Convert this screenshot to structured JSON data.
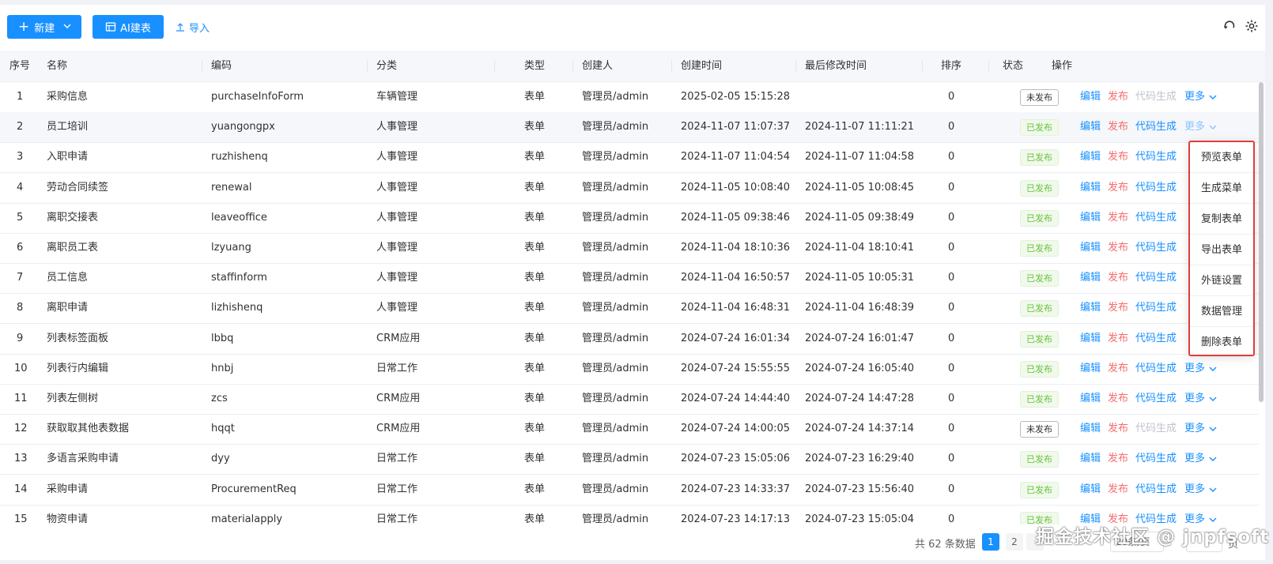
{
  "toolbar": {
    "new_label": "新建",
    "ai_label": "AI建表",
    "import_label": "导入"
  },
  "table": {
    "headers": {
      "index": "序号",
      "name": "名称",
      "code": "编码",
      "category": "分类",
      "type": "类型",
      "creator": "创建人",
      "created": "创建时间",
      "modified": "最后修改时间",
      "sort": "排序",
      "status": "状态",
      "ops": "操作"
    },
    "rows": [
      {
        "index": "1",
        "name": "采购信息",
        "code": "purchaseInfoForm",
        "category": "车辆管理",
        "type": "表单",
        "creator": "管理员/admin",
        "created": "2025-02-05 15:15:28",
        "modified": "",
        "sort": "0",
        "status": "未发布",
        "published": false,
        "code_gen": "代码生成",
        "more": "更多"
      },
      {
        "index": "2",
        "name": "员工培训",
        "code": "yuangongpx",
        "category": "人事管理",
        "type": "表单",
        "creator": "管理员/admin",
        "created": "2024-11-07 11:07:37",
        "modified": "2024-11-07 11:11:21",
        "sort": "0",
        "status": "已发布",
        "published": true,
        "code_gen": "代码生成",
        "more": "更多"
      },
      {
        "index": "3",
        "name": "入职申请",
        "code": "ruzhishenq",
        "category": "人事管理",
        "type": "表单",
        "creator": "管理员/admin",
        "created": "2024-11-07 11:04:54",
        "modified": "2024-11-07 11:04:58",
        "sort": "0",
        "status": "已发布",
        "published": true,
        "code_gen": "代码生成",
        "more": ""
      },
      {
        "index": "4",
        "name": "劳动合同续签",
        "code": "renewal",
        "category": "人事管理",
        "type": "表单",
        "creator": "管理员/admin",
        "created": "2024-11-05 10:08:40",
        "modified": "2024-11-05 10:08:45",
        "sort": "0",
        "status": "已发布",
        "published": true,
        "code_gen": "代码生成",
        "more": ""
      },
      {
        "index": "5",
        "name": "离职交接表",
        "code": "leaveoffice",
        "category": "人事管理",
        "type": "表单",
        "creator": "管理员/admin",
        "created": "2024-11-05 09:38:46",
        "modified": "2024-11-05 09:38:49",
        "sort": "0",
        "status": "已发布",
        "published": true,
        "code_gen": "代码生成",
        "more": ""
      },
      {
        "index": "6",
        "name": "离职员工表",
        "code": "lzyuang",
        "category": "人事管理",
        "type": "表单",
        "creator": "管理员/admin",
        "created": "2024-11-04 18:10:36",
        "modified": "2024-11-04 18:10:41",
        "sort": "0",
        "status": "已发布",
        "published": true,
        "code_gen": "代码生成",
        "more": ""
      },
      {
        "index": "7",
        "name": "员工信息",
        "code": "staffinform",
        "category": "人事管理",
        "type": "表单",
        "creator": "管理员/admin",
        "created": "2024-11-04 16:50:57",
        "modified": "2024-11-05 10:05:31",
        "sort": "0",
        "status": "已发布",
        "published": true,
        "code_gen": "代码生成",
        "more": ""
      },
      {
        "index": "8",
        "name": "离职申请",
        "code": "lizhishenq",
        "category": "人事管理",
        "type": "表单",
        "creator": "管理员/admin",
        "created": "2024-11-04 16:48:31",
        "modified": "2024-11-04 16:48:39",
        "sort": "0",
        "status": "已发布",
        "published": true,
        "code_gen": "代码生成",
        "more": ""
      },
      {
        "index": "9",
        "name": "列表标签面板",
        "code": "lbbq",
        "category": "CRM应用",
        "type": "表单",
        "creator": "管理员/admin",
        "created": "2024-07-24 16:01:34",
        "modified": "2024-07-24 16:01:47",
        "sort": "0",
        "status": "已发布",
        "published": true,
        "code_gen": "代码生成",
        "more": ""
      },
      {
        "index": "10",
        "name": "列表行内编辑",
        "code": "hnbj",
        "category": "日常工作",
        "type": "表单",
        "creator": "管理员/admin",
        "created": "2024-07-24 15:55:55",
        "modified": "2024-07-24 16:05:40",
        "sort": "0",
        "status": "已发布",
        "published": true,
        "code_gen": "代码生成",
        "more": "更多"
      },
      {
        "index": "11",
        "name": "列表左侧树",
        "code": "zcs",
        "category": "CRM应用",
        "type": "表单",
        "creator": "管理员/admin",
        "created": "2024-07-24 14:44:40",
        "modified": "2024-07-24 14:47:28",
        "sort": "0",
        "status": "已发布",
        "published": true,
        "code_gen": "代码生成",
        "more": "更多"
      },
      {
        "index": "12",
        "name": "获取取其他表数据",
        "code": "hqqt",
        "category": "CRM应用",
        "type": "表单",
        "creator": "管理员/admin",
        "created": "2024-07-24 14:00:05",
        "modified": "2024-07-24 14:37:14",
        "sort": "0",
        "status": "未发布",
        "published": false,
        "code_gen": "代码生成",
        "more": "更多"
      },
      {
        "index": "13",
        "name": "多语言采购申请",
        "code": "dyy",
        "category": "日常工作",
        "type": "表单",
        "creator": "管理员/admin",
        "created": "2024-07-23 15:05:06",
        "modified": "2024-07-23 16:29:40",
        "sort": "0",
        "status": "已发布",
        "published": true,
        "code_gen": "代码生成",
        "more": "更多"
      },
      {
        "index": "14",
        "name": "采购申请",
        "code": "ProcurementReq",
        "category": "日常工作",
        "type": "表单",
        "creator": "管理员/admin",
        "created": "2024-07-23 14:33:37",
        "modified": "2024-07-23 15:56:40",
        "sort": "0",
        "status": "已发布",
        "published": true,
        "code_gen": "代码生成",
        "more": "更多"
      },
      {
        "index": "15",
        "name": "物资申请",
        "code": "materialapply",
        "category": "日常工作",
        "type": "表单",
        "creator": "管理员/admin",
        "created": "2024-07-23 14:17:13",
        "modified": "2024-07-23 15:05:04",
        "sort": "0",
        "status": "已发布",
        "published": true,
        "code_gen": "代码生成",
        "more": "更多"
      }
    ],
    "op_edit": "编辑",
    "op_publish": "发布"
  },
  "dropdown": {
    "items": [
      "预览表单",
      "生成菜单",
      "复制表单",
      "导出表单",
      "外链设置",
      "数据管理",
      "删除表单"
    ]
  },
  "pagination": {
    "total": "共 62 条数据",
    "page1": "1",
    "page2": "2",
    "page_size": "20条/页",
    "goto_suffix": "页"
  },
  "watermark": "掘金技术社区 @ jnpfsoft",
  "colors": {
    "primary": "#1890ff",
    "danger": "#f56c6c",
    "success": "#67c23a",
    "highlight_border": "#e03c3c"
  }
}
